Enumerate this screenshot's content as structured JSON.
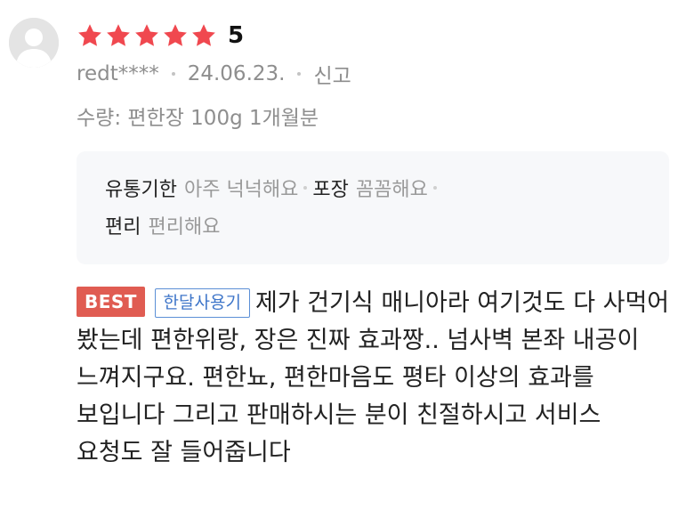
{
  "review": {
    "rating_stars": 5,
    "rating_value": "5",
    "user": "redt****",
    "date": "24.06.23.",
    "report_label": "신고",
    "option": "수량: 편한장 100g 1개월분",
    "evaluations": [
      {
        "key": "유통기한",
        "value": "아주 넉넉해요"
      },
      {
        "key": "포장",
        "value": "꼼꼼해요"
      },
      {
        "key": "편리",
        "value": "편리해요"
      }
    ],
    "badges": {
      "best": "BEST",
      "month": "한달사용기"
    },
    "text": "제가 건기식 매니아라 여기것도 다 사먹어 봤는데 편한위랑, 장은 진짜 효과짱.. 넘사벽 본좌 내공이 느껴지구요. 편한뇨, 편한마음도 평타 이상의 효과를 보입니다 그리고 판매하시는 분이 친절하시고 서비스 요청도 잘 들어줍니다"
  },
  "colors": {
    "star": "#f0484f",
    "best_badge": "#e05c52",
    "month_badge": "#3f76c9",
    "eval_box_bg": "#f7f8fa"
  },
  "icons": {
    "avatar": "default-profile-icon",
    "star": "star-icon"
  }
}
